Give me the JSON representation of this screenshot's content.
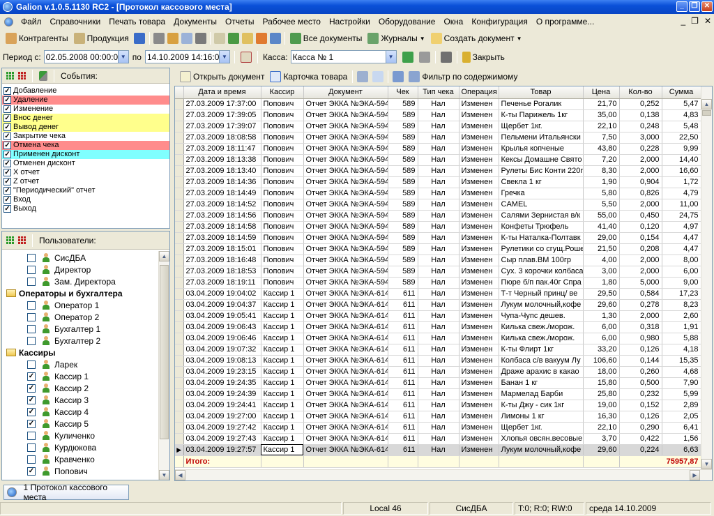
{
  "window": {
    "title": "Galion  v.1.0.5.1130 RC2 - [Протокол кассового места]"
  },
  "menu": [
    "Файл",
    "Справочники",
    "Печать товара",
    "Документы",
    "Отчеты",
    "Рабочее место",
    "Настройки",
    "Оборудование",
    "Окна",
    "Конфигурация",
    "О программе..."
  ],
  "toolbar1": {
    "counterparties": "Контрагенты",
    "products": "Продукция",
    "all_docs": "Все документы",
    "journals": "Журналы",
    "create_doc": "Создать документ"
  },
  "filter": {
    "period_label": "Период с:",
    "date_from": "02.05.2008 00:00:00",
    "to_label": "по",
    "date_to": "14.10.2009 14:16:04",
    "kassa_label": "Касса:",
    "kassa_value": "Касса № 1",
    "close_label": "Закрыть"
  },
  "events": {
    "header": "События:",
    "items": [
      {
        "label": "Добавление",
        "bg": "#ffffff"
      },
      {
        "label": "Удаление",
        "bg": "#ff8c8c"
      },
      {
        "label": "Изменение",
        "bg": "#ffffff"
      },
      {
        "label": "Внос денег",
        "bg": "#ffff8c"
      },
      {
        "label": "Вывод денег",
        "bg": "#ffff8c"
      },
      {
        "label": "Закрытие чека",
        "bg": "#ffffff"
      },
      {
        "label": "Отмена чека",
        "bg": "#ff8c8c"
      },
      {
        "label": "Применен дисконт",
        "bg": "#80ffff"
      },
      {
        "label": "Отменен дисконт",
        "bg": "#ffffff"
      },
      {
        "label": "X отчет",
        "bg": "#ffffff"
      },
      {
        "label": "Z отчет",
        "bg": "#ffffff"
      },
      {
        "label": "\"Периодический\" отчет",
        "bg": "#ffffff"
      },
      {
        "label": "Вход",
        "bg": "#ffffff"
      },
      {
        "label": "Выход",
        "bg": "#ffffff"
      }
    ]
  },
  "users": {
    "header": "Пользователи:",
    "rows": [
      {
        "type": "user",
        "label": "СисДБА",
        "checked": false
      },
      {
        "type": "user",
        "label": "Директор",
        "checked": false
      },
      {
        "type": "user",
        "label": "Зам. Директора",
        "checked": false
      },
      {
        "type": "group",
        "label": "Операторы и бухгалтера"
      },
      {
        "type": "user",
        "label": "Оператор 1",
        "checked": false
      },
      {
        "type": "user",
        "label": "Оператор 2",
        "checked": false
      },
      {
        "type": "user",
        "label": "Бухгалтер 1",
        "checked": false
      },
      {
        "type": "user",
        "label": "Бухгалтер 2",
        "checked": false
      },
      {
        "type": "group",
        "label": "Кассиры"
      },
      {
        "type": "user",
        "label": "Ларек",
        "checked": false
      },
      {
        "type": "user",
        "label": "Кассир 1",
        "checked": true
      },
      {
        "type": "user",
        "label": "Кассир 2",
        "checked": true
      },
      {
        "type": "user",
        "label": "Кассир 3",
        "checked": true
      },
      {
        "type": "user",
        "label": "Кассир 4",
        "checked": true
      },
      {
        "type": "user",
        "label": "Кассир 5",
        "checked": true
      },
      {
        "type": "user",
        "label": "Куличенко",
        "checked": false
      },
      {
        "type": "user",
        "label": "Курдюкова",
        "checked": false
      },
      {
        "type": "user",
        "label": "Кравченко",
        "checked": false
      },
      {
        "type": "user",
        "label": "Попович",
        "checked": true
      }
    ]
  },
  "toolbar2": {
    "open_doc": "Открыть документ",
    "product_card": "Карточка товара",
    "content_filter": "Фильтр по содержимому"
  },
  "table": {
    "columns": [
      "Дата и время",
      "Кассир",
      "Документ",
      "Чек",
      "Тип чека",
      "Операция",
      "Товар",
      "Цена",
      "Кол-во",
      "Сумма"
    ],
    "rows": [
      [
        "27.03.2009 17:37:00",
        "Попович",
        "Отчет ЭККА №ЭКА-594",
        "589",
        "Нал",
        "Изменен",
        "Печенье Рогалик",
        "21,70",
        "0,252",
        "5,47"
      ],
      [
        "27.03.2009 17:39:05",
        "Попович",
        "Отчет ЭККА №ЭКА-594",
        "589",
        "Нал",
        "Изменен",
        "К-ты Парижель 1кг",
        "35,00",
        "0,138",
        "4,83"
      ],
      [
        "27.03.2009 17:39:07",
        "Попович",
        "Отчет ЭККА №ЭКА-594",
        "589",
        "Нал",
        "Изменен",
        "Щербет 1кг.",
        "22,10",
        "0,248",
        "5,48"
      ],
      [
        "27.03.2009 18:08:58",
        "Попович",
        "Отчет ЭККА №ЭКА-594",
        "589",
        "Нал",
        "Изменен",
        "Пельмени Итальянски",
        "7,50",
        "3,000",
        "22,50"
      ],
      [
        "27.03.2009 18:11:47",
        "Попович",
        "Отчет ЭККА №ЭКА-594",
        "589",
        "Нал",
        "Изменен",
        "Крылья копченые",
        "43,80",
        "0,228",
        "9,99"
      ],
      [
        "27.03.2009 18:13:38",
        "Попович",
        "Отчет ЭККА №ЭКА-594",
        "589",
        "Нал",
        "Изменен",
        "Кексы Домашне Свято",
        "7,20",
        "2,000",
        "14,40"
      ],
      [
        "27.03.2009 18:13:40",
        "Попович",
        "Отчет ЭККА №ЭКА-594",
        "589",
        "Нал",
        "Изменен",
        "Рулеты Бис Конти 220г",
        "8,30",
        "2,000",
        "16,60"
      ],
      [
        "27.03.2009 18:14:36",
        "Попович",
        "Отчет ЭККА №ЭКА-594",
        "589",
        "Нал",
        "Изменен",
        "Свекла 1 кг",
        "1,90",
        "0,904",
        "1,72"
      ],
      [
        "27.03.2009 18:14:49",
        "Попович",
        "Отчет ЭККА №ЭКА-594",
        "589",
        "Нал",
        "Изменен",
        "Гречка",
        "5,80",
        "0,826",
        "4,79"
      ],
      [
        "27.03.2009 18:14:52",
        "Попович",
        "Отчет ЭККА №ЭКА-594",
        "589",
        "Нал",
        "Изменен",
        "CAMEL",
        "5,50",
        "2,000",
        "11,00"
      ],
      [
        "27.03.2009 18:14:56",
        "Попович",
        "Отчет ЭККА №ЭКА-594",
        "589",
        "Нал",
        "Изменен",
        "Салями Зернистая в/к",
        "55,00",
        "0,450",
        "24,75"
      ],
      [
        "27.03.2009 18:14:58",
        "Попович",
        "Отчет ЭККА №ЭКА-594",
        "589",
        "Нал",
        "Изменен",
        "Конфеты Трюфель",
        "41,40",
        "0,120",
        "4,97"
      ],
      [
        "27.03.2009 18:14:59",
        "Попович",
        "Отчет ЭККА №ЭКА-594",
        "589",
        "Нал",
        "Изменен",
        "К-ты Наталка-Полтавк",
        "29,00",
        "0,154",
        "4,47"
      ],
      [
        "27.03.2009 18:15:01",
        "Попович",
        "Отчет ЭККА №ЭКА-594",
        "589",
        "Нал",
        "Изменен",
        "Рулетики со сгущ.Роше",
        "21,50",
        "0,208",
        "4,47"
      ],
      [
        "27.03.2009 18:16:48",
        "Попович",
        "Отчет ЭККА №ЭКА-594",
        "589",
        "Нал",
        "Изменен",
        "Сыр плав.ВМ 100гр",
        "4,00",
        "2,000",
        "8,00"
      ],
      [
        "27.03.2009 18:18:53",
        "Попович",
        "Отчет ЭККА №ЭКА-594",
        "589",
        "Нал",
        "Изменен",
        "Сух. 3 корочки колбаса",
        "3,00",
        "2,000",
        "6,00"
      ],
      [
        "27.03.2009 18:19:11",
        "Попович",
        "Отчет ЭККА №ЭКА-594",
        "589",
        "Нал",
        "Изменен",
        "Пюре б/п пак.40г Спра",
        "1,80",
        "5,000",
        "9,00"
      ],
      [
        "03.04.2009 19:04:02",
        "Кассир 1",
        "Отчет ЭККА №ЭКА-614",
        "611",
        "Нал",
        "Изменен",
        "Т-т Черный принц/ ве",
        "29,50",
        "0,584",
        "17,23"
      ],
      [
        "03.04.2009 19:04:37",
        "Кассир 1",
        "Отчет ЭККА №ЭКА-614",
        "611",
        "Нал",
        "Изменен",
        "Лукум молочный,кофе",
        "29,60",
        "0,278",
        "8,23"
      ],
      [
        "03.04.2009 19:05:41",
        "Кассир 1",
        "Отчет ЭККА №ЭКА-614",
        "611",
        "Нал",
        "Изменен",
        "Чупа-Чупс дешев.",
        "1,30",
        "2,000",
        "2,60"
      ],
      [
        "03.04.2009 19:06:43",
        "Кассир 1",
        "Отчет ЭККА №ЭКА-614",
        "611",
        "Нал",
        "Изменен",
        "Килька свеж./морож.",
        "6,00",
        "0,318",
        "1,91"
      ],
      [
        "03.04.2009 19:06:46",
        "Кассир 1",
        "Отчет ЭККА №ЭКА-614",
        "611",
        "Нал",
        "Изменен",
        "Килька свеж./морож.",
        "6,00",
        "0,980",
        "5,88"
      ],
      [
        "03.04.2009 19:07:32",
        "Кассир 1",
        "Отчет ЭККА №ЭКА-614",
        "611",
        "Нал",
        "Изменен",
        "К-ты Флирт 1кг",
        "33,20",
        "0,126",
        "4,18"
      ],
      [
        "03.04.2009 19:08:13",
        "Кассир 1",
        "Отчет ЭККА №ЭКА-614",
        "611",
        "Нал",
        "Изменен",
        "Колбаса с/в вакуум Лу",
        "106,60",
        "0,144",
        "15,35"
      ],
      [
        "03.04.2009 19:23:15",
        "Кассир 1",
        "Отчет ЭККА №ЭКА-614",
        "611",
        "Нал",
        "Изменен",
        "Драже арахис в какао",
        "18,00",
        "0,260",
        "4,68"
      ],
      [
        "03.04.2009 19:24:35",
        "Кассир 1",
        "Отчет ЭККА №ЭКА-614",
        "611",
        "Нал",
        "Изменен",
        "Банан 1 кг",
        "15,80",
        "0,500",
        "7,90"
      ],
      [
        "03.04.2009 19:24:39",
        "Кассир 1",
        "Отчет ЭККА №ЭКА-614",
        "611",
        "Нал",
        "Изменен",
        "Мармелад Барби",
        "25,80",
        "0,232",
        "5,99"
      ],
      [
        "03.04.2009 19:24:41",
        "Кассир 1",
        "Отчет ЭККА №ЭКА-614",
        "611",
        "Нал",
        "Изменен",
        "К-ты Джу - сик 1кг",
        "19,00",
        "0,152",
        "2,89"
      ],
      [
        "03.04.2009 19:27:00",
        "Кассир 1",
        "Отчет ЭККА №ЭКА-614",
        "611",
        "Нал",
        "Изменен",
        "Лимоны 1 кг",
        "16,30",
        "0,126",
        "2,05"
      ],
      [
        "03.04.2009 19:27:42",
        "Кассир 1",
        "Отчет ЭККА №ЭКА-614",
        "611",
        "Нал",
        "Изменен",
        "Щербет 1кг.",
        "22,10",
        "0,290",
        "6,41"
      ],
      [
        "03.04.2009 19:27:43",
        "Кассир 1",
        "Отчет ЭККА №ЭКА-614",
        "611",
        "Нал",
        "Изменен",
        "Хлопья овсян.весовые",
        "3,70",
        "0,422",
        "1,56"
      ],
      [
        "03.04.2009 19:27:57",
        "Кассир 1",
        "Отчет ЭККА №ЭКА-614",
        "611",
        "Нал",
        "Изменен",
        "Лукум молочный,кофе",
        "29,60",
        "0,224",
        "6,63"
      ]
    ],
    "total_label": "Итого:",
    "total_sum": "75957,87"
  },
  "task": {
    "label": "1 Протокол кассового места"
  },
  "status": {
    "server": "Local 46",
    "user": "СисДБА",
    "transactions": "T:0; R:0; RW:0",
    "date": "среда 14.10.2009"
  }
}
